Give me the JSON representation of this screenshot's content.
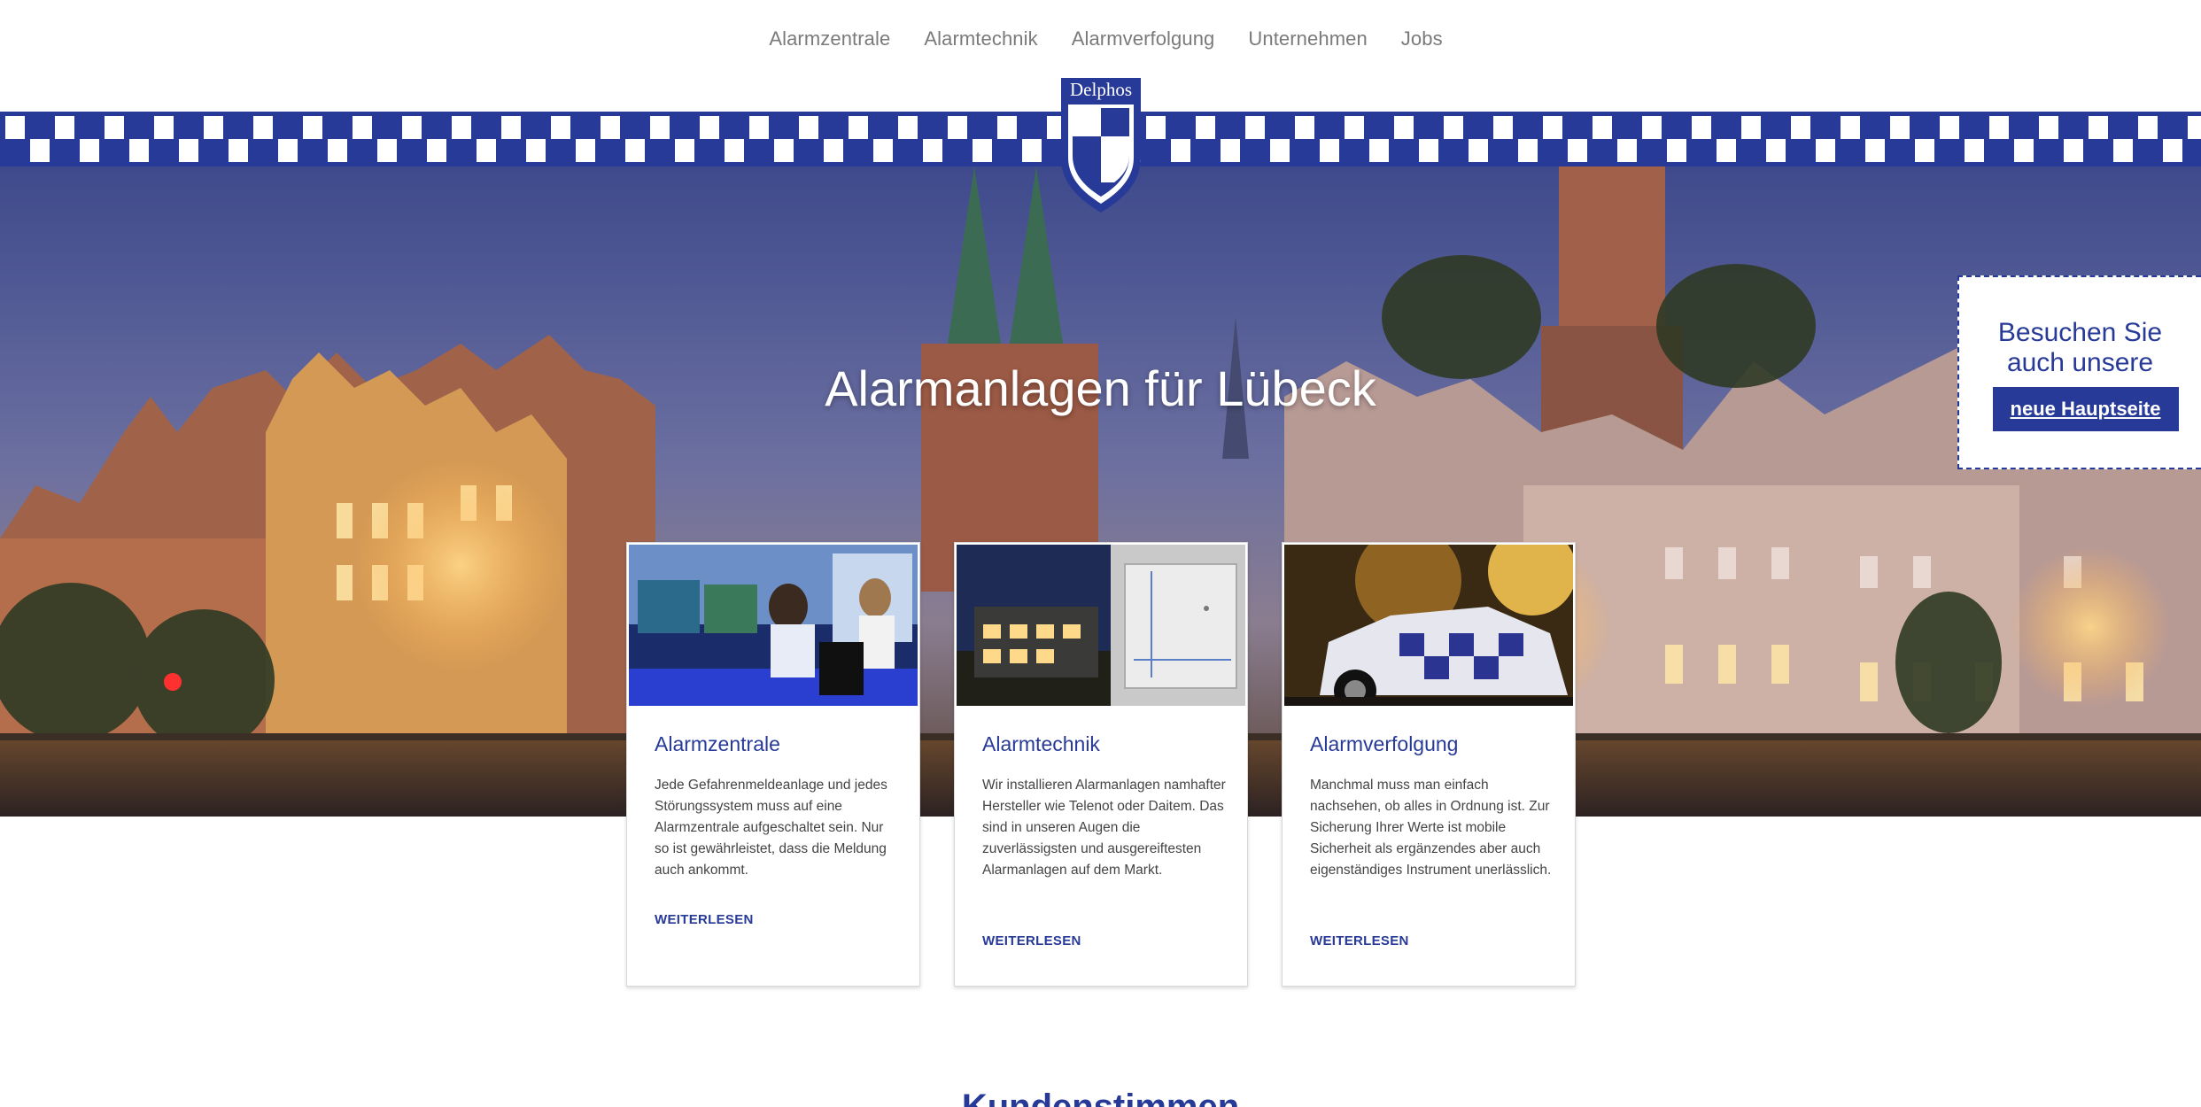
{
  "nav": {
    "items": [
      "Alarmzentrale",
      "Alarmtechnik",
      "Alarmverfolgung",
      "Unternehmen",
      "Jobs"
    ]
  },
  "logo": {
    "text": "Delphos",
    "icon": "shield-logo"
  },
  "hero": {
    "title": "Alarmanlagen für Lübeck"
  },
  "sidebox": {
    "line1": "Besuchen Sie",
    "line2": "auch unsere",
    "button": "neue Hauptseite"
  },
  "cards": [
    {
      "title": "Alarmzentrale",
      "text": "Jede Gefahrenmeldeanlage und jedes Störungssystem muss auf eine Alarmzentrale aufgeschaltet sein. Nur so ist gewährleistet, dass die Meldung auch ankommt.",
      "link": "WEITERLESEN"
    },
    {
      "title": "Alarmtechnik",
      "text": "Wir installieren Alarmanlagen namhafter Hersteller wie Telenot oder Daitem. Das sind in unseren Augen die zuverlässigsten und ausgereiftesten Alarmanlagen auf dem Markt.",
      "link": "WEITERLESEN"
    },
    {
      "title": "Alarmverfolgung",
      "text": "Manchmal muss man einfach nachsehen, ob alles in Ordnung ist. Zur Sicherung Ihrer Werte ist mobile Sicherheit als ergänzendes aber auch eigenständiges Instrument unerlässlich.",
      "link": "WEITERLESEN"
    }
  ],
  "bottom": {
    "heading": "Kundenstimmen"
  },
  "colors": {
    "brand": "#283a97",
    "nav_text": "#7a7a7a"
  }
}
